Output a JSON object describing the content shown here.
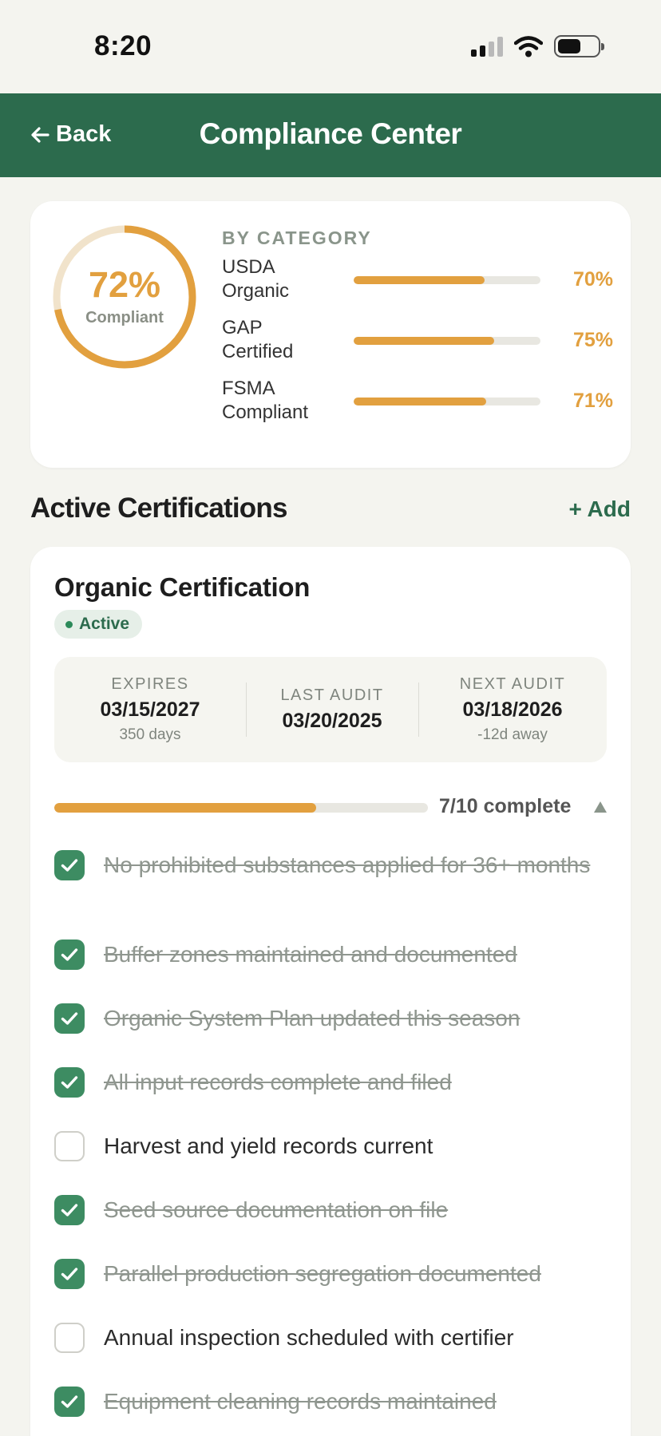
{
  "status": {
    "time": "8:20"
  },
  "header": {
    "back_label": "Back",
    "title": "Compliance Center"
  },
  "summary": {
    "overall_pct": "72%",
    "overall_value": 72,
    "overall_label": "Compliant",
    "category_heading": "BY CATEGORY",
    "categories": [
      {
        "name": "USDA Organic",
        "pct": "70%",
        "value": 70
      },
      {
        "name": "GAP Certified",
        "pct": "75%",
        "value": 75
      },
      {
        "name": "FSMA Compliant",
        "pct": "71%",
        "value": 71
      }
    ]
  },
  "section": {
    "title": "Active Certifications",
    "add_label": "+ Add"
  },
  "certification": {
    "title": "Organic Certification",
    "status": "Active",
    "expires": {
      "label": "EXPIRES",
      "date": "03/15/2027",
      "sub": "350 days"
    },
    "last_audit": {
      "label": "LAST AUDIT",
      "date": "03/20/2025"
    },
    "next_audit": {
      "label": "NEXT AUDIT",
      "date": "03/18/2026",
      "sub": "-12d away"
    },
    "progress_text": "7/10 complete",
    "progress_value": 0.7,
    "checklist": [
      {
        "text": "No prohibited substances applied for 36+ months",
        "done": true
      },
      {
        "text": "Buffer zones maintained and documented",
        "done": true
      },
      {
        "text": "Organic System Plan updated this season",
        "done": true
      },
      {
        "text": "All input records complete and filed",
        "done": true
      },
      {
        "text": "Harvest and yield records current",
        "done": false
      },
      {
        "text": "Seed source documentation on file",
        "done": true
      },
      {
        "text": "Parallel production segregation documented",
        "done": true
      },
      {
        "text": "Annual inspection scheduled with certifier",
        "done": false
      },
      {
        "text": "Equipment cleaning records maintained",
        "done": true
      }
    ]
  },
  "colors": {
    "brand": "#2c6b4d",
    "accent": "#e2a03f",
    "check": "#3d8c62"
  }
}
